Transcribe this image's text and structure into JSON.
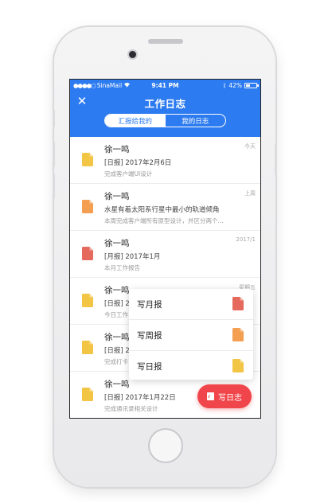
{
  "status": {
    "carrier": "SinaMail",
    "time": "9:41 PM",
    "battery": "42%",
    "battery_level": 0.42
  },
  "header": {
    "title": "工作日志",
    "close_icon": "close-icon",
    "tabs": [
      {
        "label": "汇报给我的",
        "active": true
      },
      {
        "label": "我的日志",
        "active": false
      }
    ]
  },
  "colors": {
    "primary": "#2d7bf0",
    "yellow": "#f3c544",
    "orange": "#f49e52",
    "red": "#e56a5d",
    "fab": "#f0454a"
  },
  "reports": [
    {
      "name": "徐一鸣",
      "title": "[日报] 2017年2月6日",
      "desc": "完成客户端UI设计",
      "date": "今天",
      "icon": "yellow"
    },
    {
      "name": "徐一鸣",
      "title": "水星有着太阳系行星中最小的轨道倾角",
      "desc": "本周完成客户端所有原型设计，并区分两个...",
      "date": "上周",
      "icon": "orange"
    },
    {
      "name": "徐一鸣",
      "title": "[月报] 2017年1月",
      "desc": "本月工作报告",
      "date": "2017/1",
      "icon": "red"
    },
    {
      "name": "徐一鸣",
      "title": "[日报] 2",
      "desc": "今日工作",
      "date": "星期五",
      "icon": "yellow"
    },
    {
      "name": "徐一鸣",
      "title": "[日报] 2",
      "desc": "完成打卡",
      "date": "",
      "icon": "yellow"
    },
    {
      "name": "徐一鸣",
      "title": "[日报] 2017年1月22日",
      "desc": "完成通讯录相关设计",
      "date": "",
      "icon": "yellow"
    },
    {
      "name": "徐一鸣",
      "title": "",
      "desc": "",
      "date": "星期五",
      "icon": "yellow"
    }
  ],
  "popup": [
    {
      "label": "写月报",
      "icon": "red"
    },
    {
      "label": "写周报",
      "icon": "orange"
    },
    {
      "label": "写日报",
      "icon": "yellow"
    }
  ],
  "fab": {
    "label": "写日志",
    "icon": "edit-icon"
  }
}
